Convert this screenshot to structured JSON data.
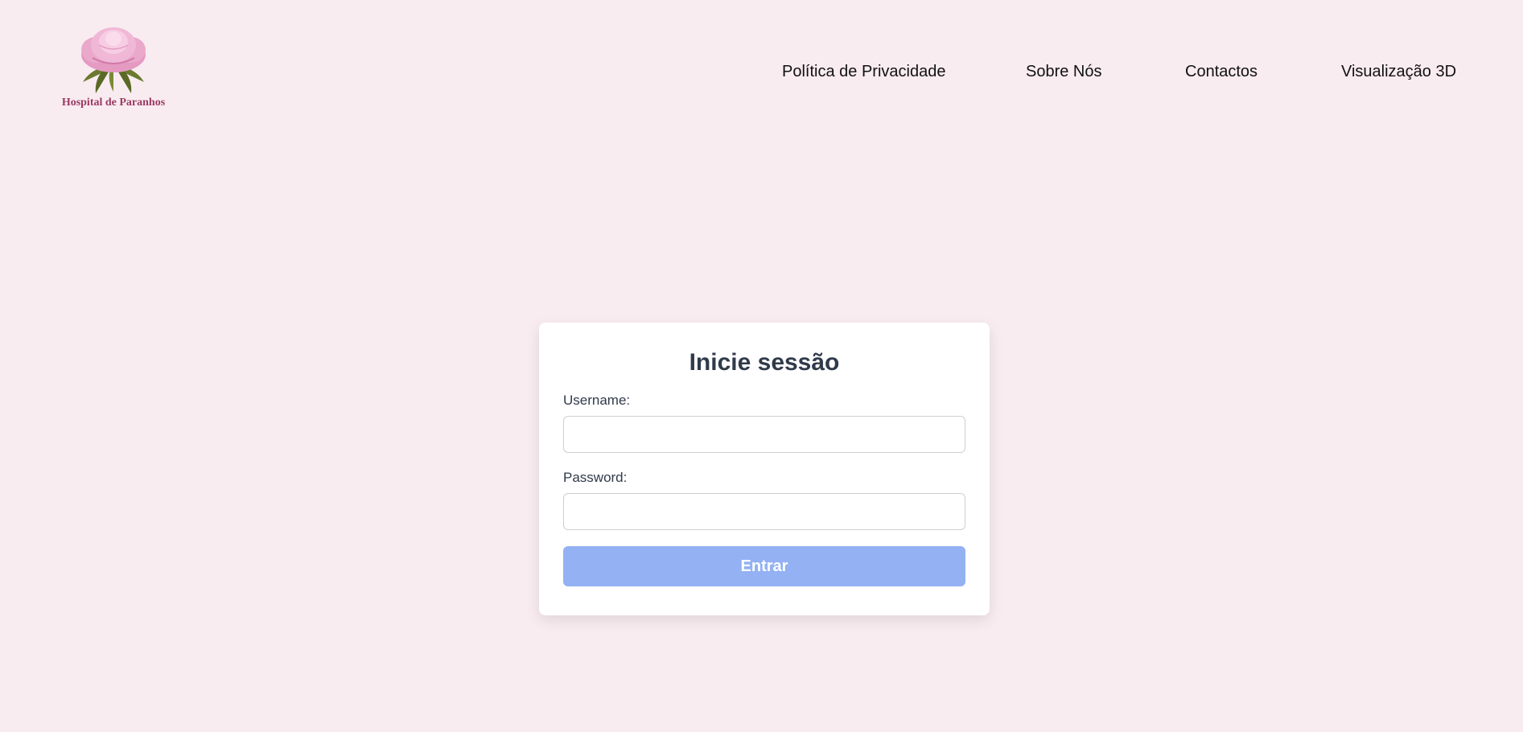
{
  "header": {
    "logo": {
      "icon": "peony-flower-icon",
      "text": "Hospital de Paranhos",
      "text_color": "#9b3b63"
    },
    "nav": [
      {
        "label": "Política de Privacidade"
      },
      {
        "label": "Sobre Nós"
      },
      {
        "label": "Contactos"
      },
      {
        "label": "Visualização 3D"
      }
    ]
  },
  "login": {
    "title": "Inicie sessão",
    "username_label": "Username:",
    "username_value": "",
    "password_label": "Password:",
    "password_value": "",
    "submit_label": "Entrar",
    "submit_color": "#93b1f3"
  },
  "colors": {
    "background": "#f9ecf1",
    "card": "#ffffff",
    "heading": "#2f3a4a"
  }
}
